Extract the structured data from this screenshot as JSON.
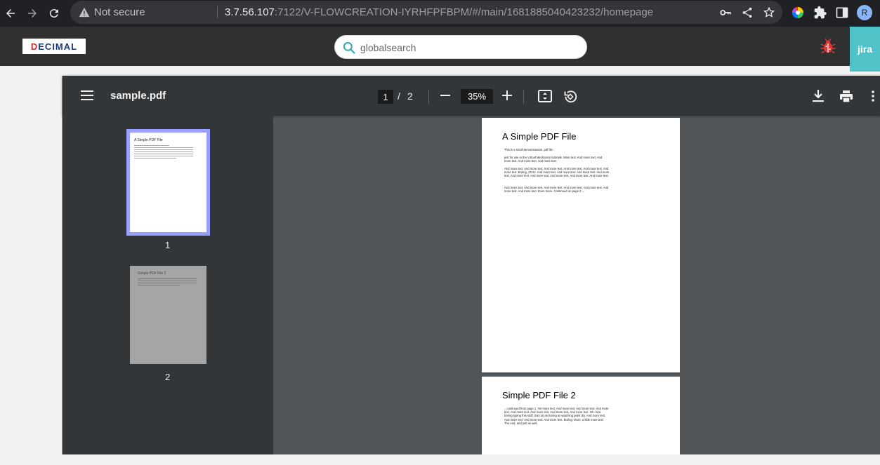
{
  "browser": {
    "security_label": "Not secure",
    "url_host": "3.7.56.107",
    "url_rest": ":7122/V-FLOWCREATION-IYRHFPFBPM/#/main/1681885040423232/homepage",
    "profile_initial": "R"
  },
  "app": {
    "logo_text_d": "D",
    "logo_text_rest": "ECIMAL",
    "search_placeholder": "globalsearch",
    "jira_label": "jira"
  },
  "pdf": {
    "title": "sample.pdf",
    "current_page": "1",
    "page_separator": "/",
    "total_pages": "2",
    "zoom": "35%",
    "thumbnails": [
      {
        "number": "1",
        "title": "A Simple PDF File"
      },
      {
        "number": "2",
        "title": "Simple PDF File 2"
      }
    ],
    "page1": {
      "heading": "A Simple PDF File",
      "paragraphs": [
        "This is a small demonstration .pdf file -",
        "just for use in the Virtual Mechanics tutorials. More text. And more text. And more text. And more text. And more text.",
        "And more text. And more text. And more text. And more text. And more text. And more text. Boring, zzzzz. And more text. And more text. And more text. And more text. And more text. And more text. And more text. And more text. And more text.",
        "And more text. And more text. And more text. And more text. And more text. And more text. And more text. Even more. Continued on page 2 ..."
      ]
    },
    "page2": {
      "heading": "Simple PDF File 2",
      "paragraphs": [
        "...continued from page 1. Yet more text. And more text. And more text. And more text. And more text. And more text. And more text. And more text. Oh, how boring typing this stuff. But not as boring as watching paint dry. And more text. And more text. And more text. And more text. Boring.  More, a little more text. The end, and just as well."
      ]
    }
  }
}
